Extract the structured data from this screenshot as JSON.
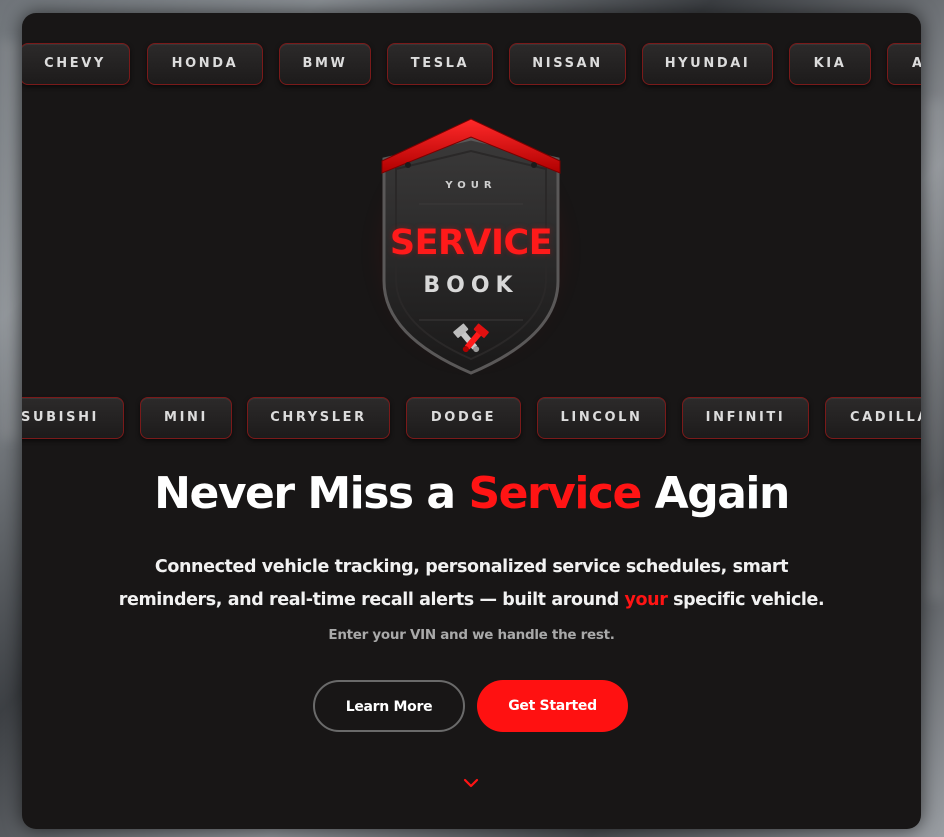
{
  "brands_top": [
    "CHEVY",
    "HONDA",
    "BMW",
    "TESLA",
    "NISSAN",
    "HYUNDAI",
    "KIA",
    "A"
  ],
  "brands_bottom": [
    "TSUBISHI",
    "MINI",
    "CHRYSLER",
    "DODGE",
    "LINCOLN",
    "INFINITI",
    "CADILLA"
  ],
  "logo": {
    "top_text": "YOUR",
    "main_text": "SERVICE",
    "sub_text": "BOOK"
  },
  "hero": {
    "headline_pre": "Never Miss a ",
    "headline_accent": "Service",
    "headline_post": " Again",
    "subtitle_line1": "Connected vehicle tracking, personalized service schedules, smart",
    "subtitle_line2_pre": "reminders, and real-time recall alerts — built around ",
    "subtitle_line2_accent": "your",
    "subtitle_line2_post": " specific vehicle.",
    "note": "Enter your VIN and we handle the rest."
  },
  "buttons": {
    "learn_more": "Learn More",
    "get_started": "Get Started"
  },
  "icons": {
    "scroll": "chevron-down-icon",
    "emblem": "crossed-pistons-icon"
  },
  "colors": {
    "accent": "#ff1414",
    "card_bg": "#181616",
    "chip_border": "#7a1a1a"
  }
}
